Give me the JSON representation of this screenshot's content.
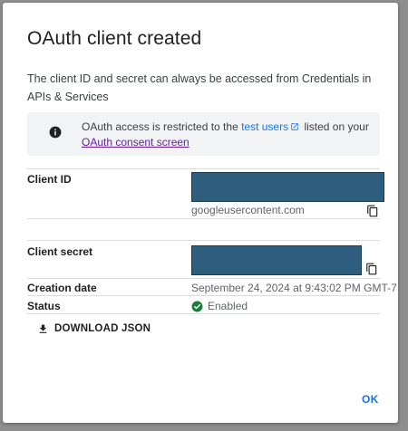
{
  "dialog": {
    "title": "OAuth client created",
    "description": "The client ID and secret can always be accessed from Credentials in APIs & Services"
  },
  "notice": {
    "icon": "info-icon",
    "text_before": "OAuth access is restricted to the ",
    "test_users_link": "test users",
    "text_after": " listed on your ",
    "consent_link": "OAuth consent screen"
  },
  "fields": {
    "client_id": {
      "label": "Client ID",
      "suffix": "googleusercontent.com"
    },
    "client_secret": {
      "label": "Client secret"
    },
    "creation_date": {
      "label": "Creation date",
      "value": "September 24, 2024 at 9:43:02 PM GMT-7"
    },
    "status": {
      "label": "Status",
      "value": "Enabled"
    }
  },
  "actions": {
    "download_label": "DOWNLOAD JSON",
    "ok_label": "OK"
  },
  "colors": {
    "accent": "#1a73e8",
    "visited_link": "#681da8",
    "redaction": "#2e5e7e",
    "enabled": "#188038"
  }
}
